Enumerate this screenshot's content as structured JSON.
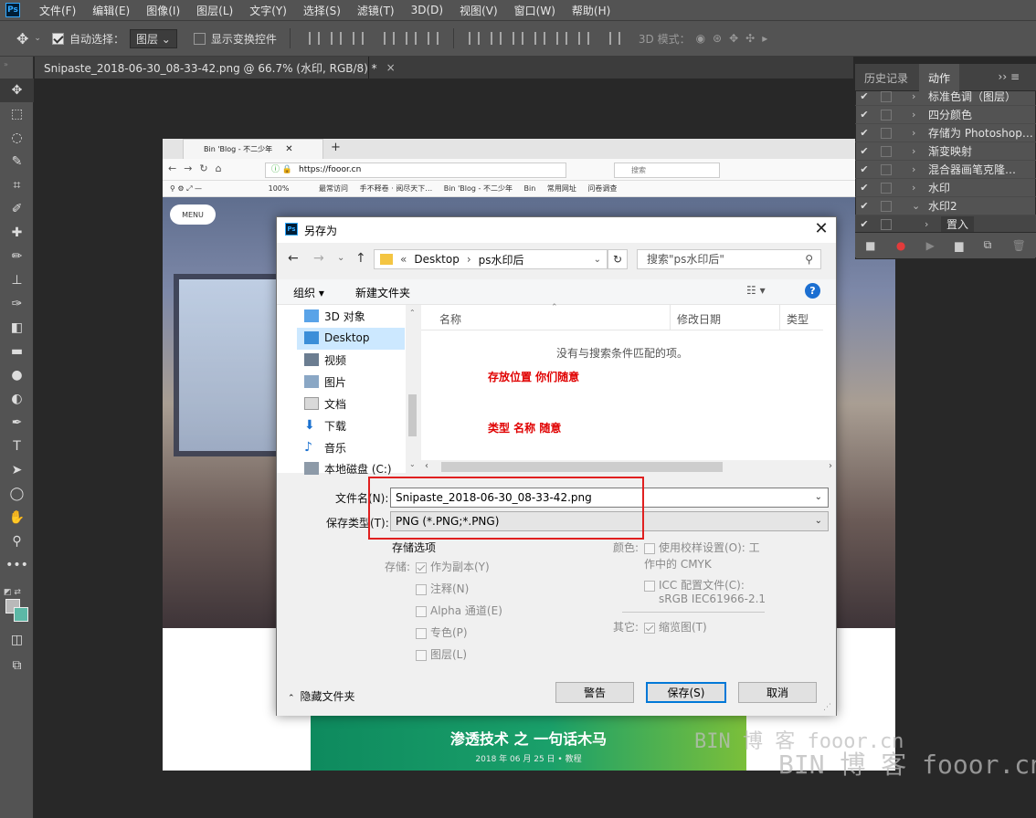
{
  "app": {
    "logo": "Ps"
  },
  "menu": [
    "文件(F)",
    "编辑(E)",
    "图像(I)",
    "图层(L)",
    "文字(Y)",
    "选择(S)",
    "滤镜(T)",
    "3D(D)",
    "视图(V)",
    "窗口(W)",
    "帮助(H)"
  ],
  "options": {
    "auto_select_label": "自动选择：",
    "auto_select_value": "图层",
    "show_transform_label": "显示变换控件",
    "mode_3d_label": "3D 模式："
  },
  "document": {
    "tab_title": "Snipaste_2018-06-30_08-33-42.png @ 66.7% (水印, RGB/8) *",
    "close": "×"
  },
  "tools": [
    {
      "name": "move-tool",
      "glyph": "✥"
    },
    {
      "name": "marquee-tool",
      "glyph": "⬚"
    },
    {
      "name": "lasso-tool",
      "glyph": "◌"
    },
    {
      "name": "quick-select-tool",
      "glyph": "✎"
    },
    {
      "name": "crop-tool",
      "glyph": "⌗"
    },
    {
      "name": "eyedropper-tool",
      "glyph": "✐"
    },
    {
      "name": "healing-tool",
      "glyph": "✚"
    },
    {
      "name": "brush-tool",
      "glyph": "✏"
    },
    {
      "name": "stamp-tool",
      "glyph": "⊥"
    },
    {
      "name": "history-brush-tool",
      "glyph": "✑"
    },
    {
      "name": "eraser-tool",
      "glyph": "◧"
    },
    {
      "name": "gradient-tool",
      "glyph": "▬"
    },
    {
      "name": "blur-tool",
      "glyph": "●"
    },
    {
      "name": "dodge-tool",
      "glyph": "◐"
    },
    {
      "name": "pen-tool",
      "glyph": "✒"
    },
    {
      "name": "type-tool",
      "glyph": "T"
    },
    {
      "name": "path-select-tool",
      "glyph": "➤"
    },
    {
      "name": "ellipse-tool",
      "glyph": "◯"
    },
    {
      "name": "hand-tool",
      "glyph": "✋"
    },
    {
      "name": "zoom-tool",
      "glyph": "⚲"
    },
    {
      "name": "more-tools",
      "glyph": "•••"
    }
  ],
  "browser": {
    "tab_title": "Bin 'Blog - 不二少年",
    "new_tab": "+",
    "url": "https://fooor.cn",
    "search_placeholder": "搜索",
    "zoom": "100%",
    "bookmarks": [
      "最常访问",
      "手不释卷 · 阅尽天下…",
      "Bin 'Blog - 不二少年",
      "Bin",
      "常用网址",
      "问卷调查"
    ],
    "menu_pill": "MENU"
  },
  "post": {
    "title": "渗透技术 之 一句话木马",
    "date": "2018 年 06 月 25 日 • 教程"
  },
  "watermark": {
    "line1": "BIN 博 客  fooor.cn",
    "line2": "BIN 博 客  fooor.cn"
  },
  "dialog": {
    "title": "另存为",
    "close": "✕",
    "breadcrumb": [
      "«",
      "Desktop",
      "›",
      "ps水印后"
    ],
    "search_placeholder": "搜索\"ps水印后\"",
    "organize": "组织 ▾",
    "new_folder": "新建文件夹",
    "nav_items": [
      "3D 对象",
      "Desktop",
      "视频",
      "图片",
      "文档",
      "下载",
      "音乐",
      "本地磁盘 (C:)"
    ],
    "columns": {
      "name": "名称",
      "modified": "修改日期",
      "type": "类型"
    },
    "empty_message": "没有与搜索条件匹配的项。",
    "annotation1": "存放位置  你们随意",
    "annotation2": "类型   名称   随意",
    "filename_label": "文件名(N):",
    "filename_value": "Snipaste_2018-06-30_08-33-42.png",
    "filetype_label": "保存类型(T):",
    "filetype_value": "PNG (*.PNG;*.PNG)",
    "storage_options": "存储选项",
    "storage_label": "存储:",
    "as_copy": "作为副本(Y)",
    "notes": "注释(N)",
    "alpha": "Alpha 通道(E)",
    "spot": "专色(P)",
    "layers": "图层(L)",
    "color_label": "颜色:",
    "proof": "使用校样设置(O):  工作中的 CMYK",
    "icc": "ICC 配置文件(C):",
    "icc_value": "sRGB IEC61966-2.1",
    "other_label": "其它:",
    "thumbnail": "缩览图(T)",
    "hide_folders": "隐藏文件夹",
    "warning_btn": "警告",
    "save_btn": "保存(S)",
    "cancel_btn": "取消"
  },
  "panel": {
    "tabs": [
      "历史记录",
      "动作"
    ],
    "rows": [
      {
        "label": "标准色调（图层）",
        "check": "✔",
        "arrow": "›",
        "box": true
      },
      {
        "label": "四分颜色",
        "check": "✔",
        "arrow": "›",
        "box": true
      },
      {
        "label": "存储为 Photoshop…",
        "check": "✔",
        "arrow": "›",
        "box": true
      },
      {
        "label": "渐变映射",
        "check": "✔",
        "arrow": "›",
        "box": true
      },
      {
        "label": "混合器画笔克隆…",
        "check": "✔",
        "arrow": "›",
        "box": true
      },
      {
        "label": "水印",
        "check": "✔",
        "arrow": "›",
        "box": true
      },
      {
        "label": "水印2",
        "check": "✔",
        "arrow": "⌄",
        "box": true
      },
      {
        "label": "置入",
        "check": "✔",
        "arrow": "›",
        "box": true
      }
    ]
  }
}
